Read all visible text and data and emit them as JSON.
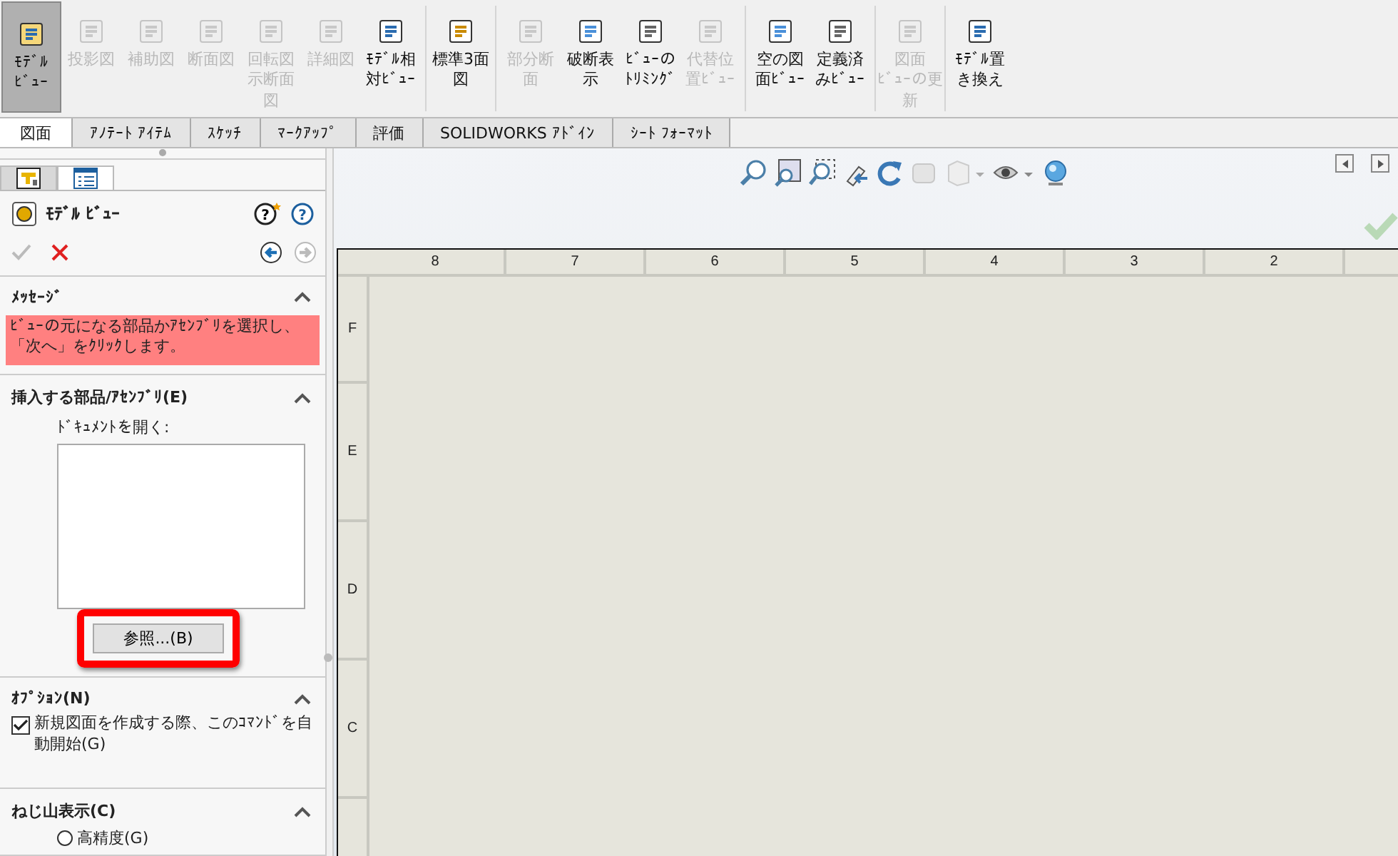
{
  "toolbar": {
    "groups": [
      [
        {
          "lines": [
            "ﾓﾃﾞﾙ",
            "ﾋﾞｭｰ"
          ],
          "disabled": false,
          "selected": true
        },
        {
          "lines": [
            "投影図"
          ],
          "disabled": true,
          "selected": false
        },
        {
          "lines": [
            "補助図"
          ],
          "disabled": true,
          "selected": false
        },
        {
          "lines": [
            "断面図"
          ],
          "disabled": true,
          "selected": false
        },
        {
          "lines": [
            "回転図",
            "示断面",
            "図"
          ],
          "disabled": true,
          "selected": false
        },
        {
          "lines": [
            "詳細図"
          ],
          "disabled": true,
          "selected": false
        },
        {
          "lines": [
            "ﾓﾃﾞﾙ相",
            "対ﾋﾞｭｰ"
          ],
          "disabled": false,
          "selected": false
        }
      ],
      [
        {
          "lines": [
            "標準3面",
            "図"
          ],
          "disabled": false,
          "selected": false
        }
      ],
      [
        {
          "lines": [
            "部分断",
            "面"
          ],
          "disabled": true,
          "selected": false
        },
        {
          "lines": [
            "破断表",
            "示"
          ],
          "disabled": false,
          "selected": false
        },
        {
          "lines": [
            "ﾋﾞｭｰの",
            "ﾄﾘﾐﾝｸﾞ"
          ],
          "disabled": false,
          "selected": false
        },
        {
          "lines": [
            "代替位",
            "置ﾋﾞｭｰ"
          ],
          "disabled": true,
          "selected": false
        }
      ],
      [
        {
          "lines": [
            "空の図",
            "面ﾋﾞｭｰ"
          ],
          "disabled": false,
          "selected": false
        },
        {
          "lines": [
            "定義済",
            "みﾋﾞｭｰ"
          ],
          "disabled": false,
          "selected": false
        }
      ],
      [
        {
          "lines": [
            "図面",
            "ﾋﾞｭｰの更",
            "新"
          ],
          "disabled": true,
          "selected": false
        }
      ],
      [
        {
          "lines": [
            "ﾓﾃﾞﾙ置",
            "き換え"
          ],
          "disabled": false,
          "selected": false
        }
      ]
    ]
  },
  "tabs": [
    {
      "label": "図面",
      "selected": true
    },
    {
      "label": "ｱﾉﾃｰﾄ ｱｲﾃﾑ",
      "selected": false
    },
    {
      "label": "ｽｹｯﾁ",
      "selected": false
    },
    {
      "label": "ﾏｰｸｱｯﾌﾟ",
      "selected": false
    },
    {
      "label": "評価",
      "selected": false
    },
    {
      "label": "SOLIDWORKS ｱﾄﾞｲﾝ",
      "selected": false
    },
    {
      "label": "ｼｰﾄ ﾌｫｰﾏｯﾄ",
      "selected": false
    }
  ],
  "panel": {
    "tabs": [
      {
        "selected": false
      },
      {
        "selected": true
      }
    ],
    "title": "ﾓﾃﾞﾙ ﾋﾞｭｰ",
    "help_icons": [
      "?",
      "?"
    ],
    "ok_disabled": true,
    "next_disabled": true,
    "sections": [
      {
        "kind": "message",
        "title": "ﾒｯｾｰｼﾞ",
        "text": "ﾋﾞｭｰの元になる部品かｱｾﾝﾌﾞﾘを選択し、「次へ」をｸﾘｯｸします。"
      },
      {
        "kind": "insert",
        "title": "挿入する部品/ｱｾﾝﾌﾞﾘ(E)",
        "label": "ﾄﾞｷｭﾒﾝﾄを開く:",
        "button": "参照...(B)"
      },
      {
        "kind": "options",
        "title": "ｵﾌﾟｼｮﾝ(N)",
        "checkbox": {
          "label": "新規図面を作成する際、このｺﾏﾝﾄﾞを自動開始(G)",
          "checked": true
        }
      },
      {
        "kind": "radio",
        "title": "ねじ山表示(C)",
        "radio": {
          "label": "高精度(G)",
          "selected": false
        }
      }
    ]
  },
  "sheet": {
    "columns": [
      "8",
      "7",
      "6",
      "5",
      "4",
      "3",
      "2"
    ],
    "rows": [
      "F",
      "E",
      "D",
      "C"
    ]
  }
}
